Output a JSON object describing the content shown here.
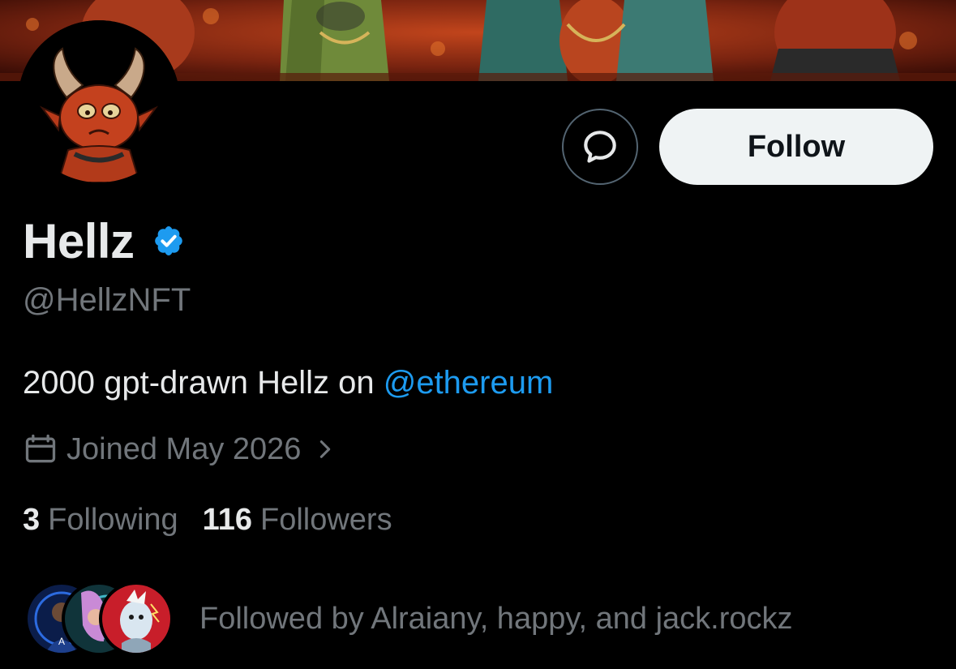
{
  "profile": {
    "display_name": "Hellz",
    "handle": "@HellzNFT",
    "bio_text": "2000 gpt-drawn Hellz on ",
    "bio_mention": "@ethereum",
    "joined": "Joined May 2026",
    "following_count": "3",
    "following_label": "Following",
    "followers_count": "116",
    "followers_label": "Followers"
  },
  "actions": {
    "follow_label": "Follow",
    "message_icon": "message-bubble-icon"
  },
  "followed_by": {
    "text": "Followed by Alraiany, happy, and jack.rockz"
  },
  "icons": {
    "verified": "verified-badge-icon",
    "calendar": "calendar-icon",
    "chevron": "chevron-right-icon"
  },
  "colors": {
    "background": "#000000",
    "primary_text": "#e7e9ea",
    "secondary_text": "#71767b",
    "accent": "#1d9bf0",
    "follow_button_bg": "#eff3f4"
  }
}
